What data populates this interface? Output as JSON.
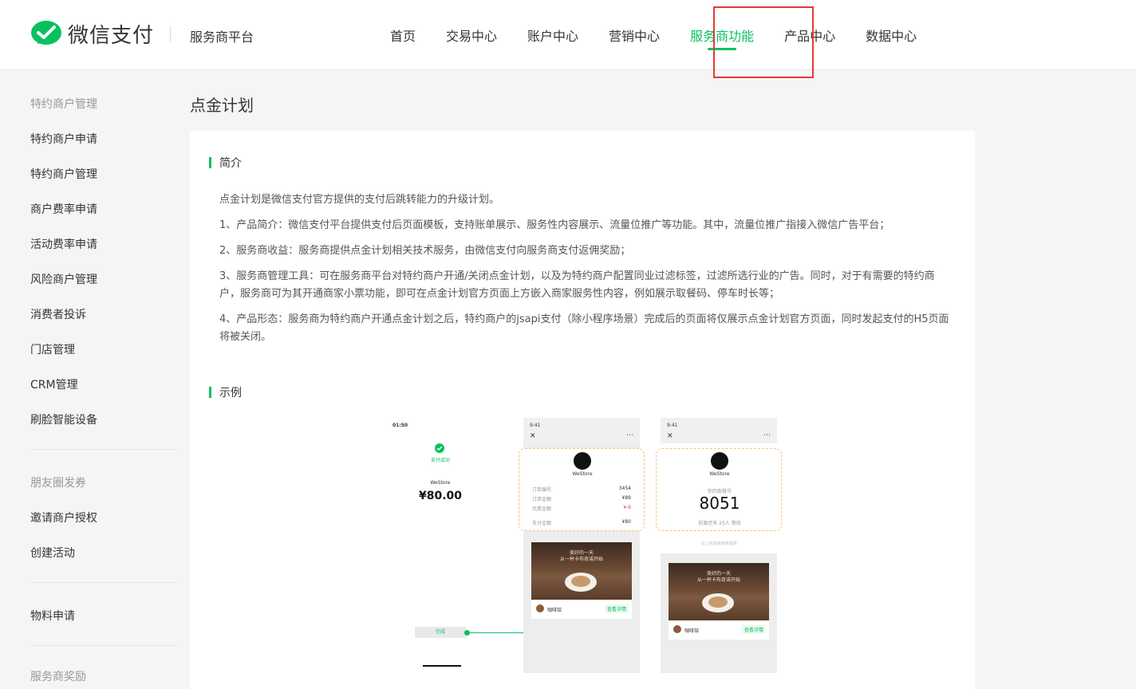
{
  "brand": {
    "name": "微信支付",
    "platform": "服务商平台",
    "accent": "#07c160"
  },
  "nav": [
    {
      "label": "首页"
    },
    {
      "label": "交易中心"
    },
    {
      "label": "账户中心"
    },
    {
      "label": "营销中心"
    },
    {
      "label": "服务商功能",
      "active": true
    },
    {
      "label": "产品中心"
    },
    {
      "label": "数据中心"
    }
  ],
  "sidebar": {
    "group1_title": "特约商户管理",
    "group1_items": [
      "特约商户申请",
      "特约商户管理",
      "商户费率申请",
      "活动费率申请",
      "风险商户管理",
      "消费者投诉",
      "门店管理",
      "CRM管理",
      "刷脸智能设备"
    ],
    "group2_title": "朋友圈发券",
    "group2_items": [
      "邀请商户授权",
      "创建活动"
    ],
    "group3_items": [
      "物料申请"
    ],
    "group4_title": "服务商奖励"
  },
  "page": {
    "title": "点金计划",
    "intro_heading": "简介",
    "intro_lines": [
      "点金计划是微信支付官方提供的支付后跳转能力的升级计划。",
      "1、产品简介：微信支付平台提供支付后页面模板，支持账单展示、服务性内容展示、流量位推广等功能。其中，流量位推广指接入微信广告平台；",
      "2、服务商收益：服务商提供点金计划相关技术服务，由微信支付向服务商支付返佣奖励；",
      "3、服务商管理工具：可在服务商平台对特约商户开通/关闭点金计划，以及为特约商户配置同业过滤标签，过滤所选行业的广告。同时，对于有需要的特约商户，服务商可为其开通商家小票功能，即可在点金计划官方页面上方嵌入商家服务性内容，例如展示取餐码、停车时长等；",
      "4、产品形态：服务商为特约商户开通点金计划之后，特约商户的jsapi支付（除小程序场景）完成后的页面将仅展示点金计划官方页面，同时发起支付的H5页面将被关闭。"
    ],
    "example_heading": "示例"
  },
  "mockups": {
    "m1": {
      "time": "01:50",
      "status": "支付成功",
      "store": "WeStore",
      "amount": "¥80.00",
      "done": "完成"
    },
    "m2": {
      "time": "9:41",
      "store": "WeStore",
      "rows": [
        [
          "订单编号",
          "3454"
        ],
        [
          "订单金额",
          "¥89"
        ],
        [
          "优惠金额",
          "¥-9"
        ],
        [
          "支付金额",
          "¥80"
        ]
      ],
      "banner_line1": "美好的一天",
      "banner_line2": "从一杯卡布奇诺开始",
      "shop": "咖啡馆",
      "detail": "查看详情"
    },
    "m3": {
      "time": "9:41",
      "store": "WeStore",
      "queue_label": "你的取餐号",
      "queue_no": "8051",
      "wait_text": "前面还有 25人 等待",
      "note": "以上内容由商家提供",
      "banner_line1": "美好的一天",
      "banner_line2": "从一杯卡布奇诺开始",
      "shop": "咖啡馆",
      "detail": "查看详情"
    }
  }
}
